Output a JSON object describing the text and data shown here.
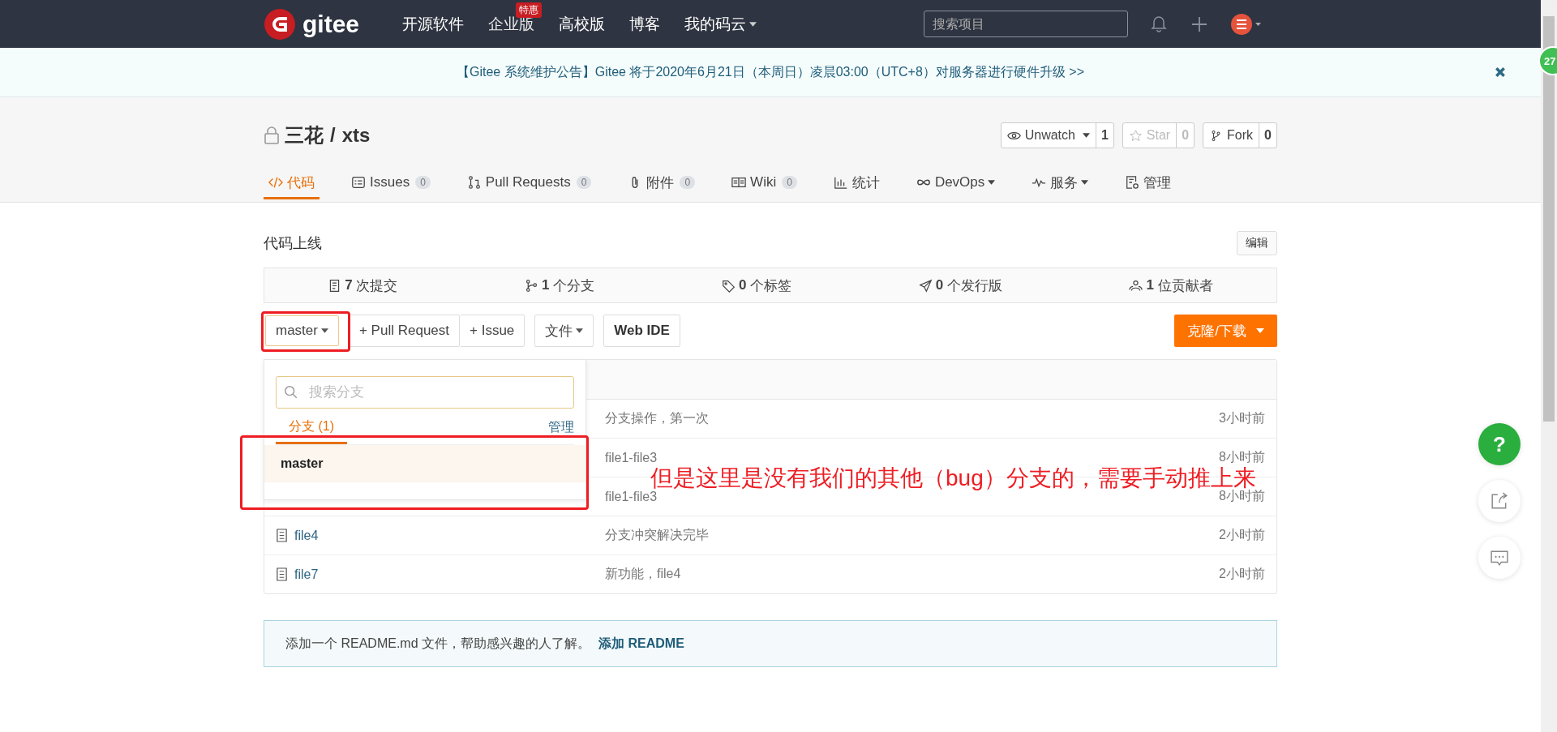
{
  "nav": {
    "logo_text": "gitee",
    "links": [
      {
        "label": "开源软件"
      },
      {
        "label": "企业版",
        "badge": "特惠"
      },
      {
        "label": "高校版"
      },
      {
        "label": "博客"
      },
      {
        "label": "我的码云",
        "dropdown": true
      }
    ],
    "search": {
      "placeholder": "搜索项目"
    }
  },
  "notice": {
    "text": "【Gitee 系统维护公告】Gitee 将于2020年6月21日（本周日）凌晨03:00（UTC+8）对服务器进行硬件升级 >>"
  },
  "repo": {
    "owner": "三花",
    "separator": "/",
    "name": "xts",
    "actions": [
      {
        "kind": "watch",
        "label": "Unwatch",
        "count": "1",
        "disabled": false,
        "dropdown": true
      },
      {
        "kind": "star",
        "label": "Star",
        "count": "0",
        "disabled": true,
        "dropdown": false
      },
      {
        "kind": "fork",
        "label": "Fork",
        "count": "0",
        "disabled": false,
        "dropdown": false
      }
    ]
  },
  "tabs": [
    {
      "kind": "code",
      "label": "代码",
      "selected": true
    },
    {
      "kind": "issues",
      "label": "Issues",
      "count": "0",
      "selected": false
    },
    {
      "kind": "pulls",
      "label": "Pull Requests",
      "count": "0",
      "selected": false
    },
    {
      "kind": "attach",
      "label": "附件",
      "count": "0",
      "selected": false
    },
    {
      "kind": "wiki",
      "label": "Wiki",
      "count": "0",
      "selected": false
    },
    {
      "kind": "stats",
      "label": "统计",
      "selected": false
    },
    {
      "kind": "devops",
      "label": "DevOps",
      "dropdown": true,
      "selected": false
    },
    {
      "kind": "service",
      "label": "服务",
      "dropdown": true,
      "selected": false
    },
    {
      "kind": "manage",
      "label": "管理",
      "selected": false
    }
  ],
  "description": "代码上线",
  "edit_button": "编辑",
  "stats": [
    {
      "kind": "commits",
      "count": "7",
      "label": "次提交"
    },
    {
      "kind": "branches",
      "count": "1",
      "label": "个分支"
    },
    {
      "kind": "tags",
      "count": "0",
      "label": "个标签"
    },
    {
      "kind": "releases",
      "count": "0",
      "label": "个发行版"
    },
    {
      "kind": "contributors",
      "count": "1",
      "label": "位贡献者"
    }
  ],
  "toolbar": {
    "branch": "master",
    "pull_request": "+ Pull Request",
    "issue": "+ Issue",
    "file_menu": "文件",
    "web_ide": "Web IDE",
    "clone": "克隆/下载"
  },
  "branch_dropdown": {
    "search_placeholder": "搜索分支",
    "tab_label": "分支 (1)",
    "manage": "管理",
    "branches": [
      {
        "name": "master",
        "selected": true
      }
    ]
  },
  "files": [
    {
      "message": "分支操作，第一次",
      "time": "3小时前"
    },
    {
      "message": "file1-file3",
      "time": "8小时前"
    },
    {
      "message": "file1-file3",
      "time": "8小时前"
    },
    {
      "name": "file4",
      "message": "分支冲突解决完毕",
      "time": "2小时前"
    },
    {
      "name": "file7",
      "message": "新功能，file4",
      "time": "2小时前"
    }
  ],
  "readme": {
    "text": "添加一个 README.md 文件，帮助感兴趣的人了解。",
    "link": "添加 README"
  },
  "annotation": "但是这里是没有我们的其他（bug）分支的，需要手动推上来",
  "float_buttons": [
    {
      "kind": "help",
      "label": "?"
    },
    {
      "kind": "share"
    },
    {
      "kind": "comment"
    }
  ],
  "corner_badge": "27"
}
